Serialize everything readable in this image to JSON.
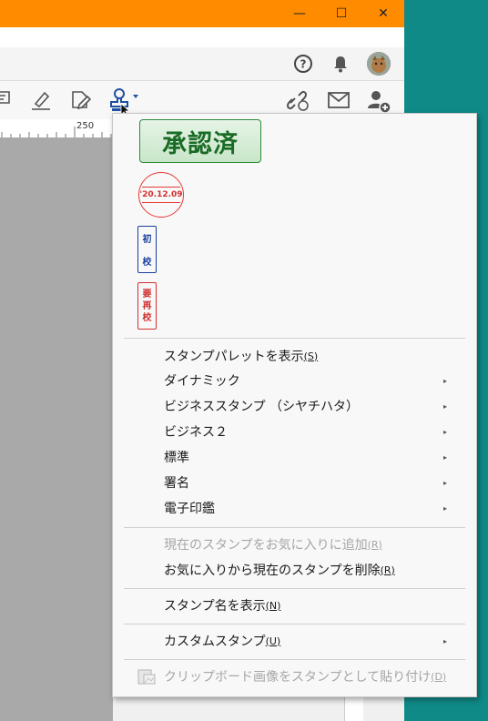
{
  "window": {
    "minimize_icon": "minimize-icon",
    "maximize_icon": "maximize-icon",
    "close_icon": "close-icon",
    "glyphs": {
      "minimize": "—",
      "maximize": "☐",
      "close": "✕"
    }
  },
  "topbar": {
    "help_icon": "help-icon",
    "bell_icon": "bell-icon",
    "avatar": "user-avatar"
  },
  "toolbar": {
    "icons": [
      "comment-icon",
      "highlighter-icon",
      "edit-icon",
      "stamp-icon",
      "link-icon",
      "mail-icon",
      "add-user-icon"
    ]
  },
  "ruler": {
    "mark": "250"
  },
  "stamps": {
    "approved": "承認済",
    "date": "'20.12.09",
    "first_proof": [
      "初",
      "校"
    ],
    "needs_reproof": [
      "要",
      "再",
      "校"
    ]
  },
  "menu": {
    "items": [
      {
        "label": "スタンプパレットを表示",
        "accel": "(S)",
        "submenu": false,
        "enabled": true
      },
      {
        "label": "ダイナミック",
        "accel": "",
        "submenu": true,
        "enabled": true
      },
      {
        "label": "ビジネススタンプ （シヤチハタ）",
        "accel": "",
        "submenu": true,
        "enabled": true
      },
      {
        "label": "ビジネス２",
        "accel": "",
        "submenu": true,
        "enabled": true
      },
      {
        "label": "標準",
        "accel": "",
        "submenu": true,
        "enabled": true
      },
      {
        "label": "署名",
        "accel": "",
        "submenu": true,
        "enabled": true
      },
      {
        "label": "電子印鑑",
        "accel": "",
        "submenu": true,
        "enabled": true
      },
      {
        "label": "現在のスタンプをお気に入りに追加",
        "accel": "(R)",
        "submenu": false,
        "enabled": false
      },
      {
        "label": "お気に入りから現在のスタンプを削除",
        "accel": "(R)",
        "submenu": false,
        "enabled": true
      },
      {
        "label": "スタンプ名を表示",
        "accel": "(N)",
        "submenu": false,
        "enabled": true
      },
      {
        "label": "カスタムスタンプ",
        "accel": "(U)",
        "submenu": true,
        "enabled": true
      },
      {
        "label": "クリップボード画像をスタンプとして貼り付け",
        "accel": "(D)",
        "submenu": false,
        "enabled": false
      }
    ],
    "submenu_arrow": "▸"
  },
  "colors": {
    "titlebar": "#ff8c00",
    "desktop": "#0f8a87",
    "stamp_green": "#1a6b25",
    "stamp_red": "#d32f2f",
    "stamp_blue": "#1a3f9e"
  }
}
